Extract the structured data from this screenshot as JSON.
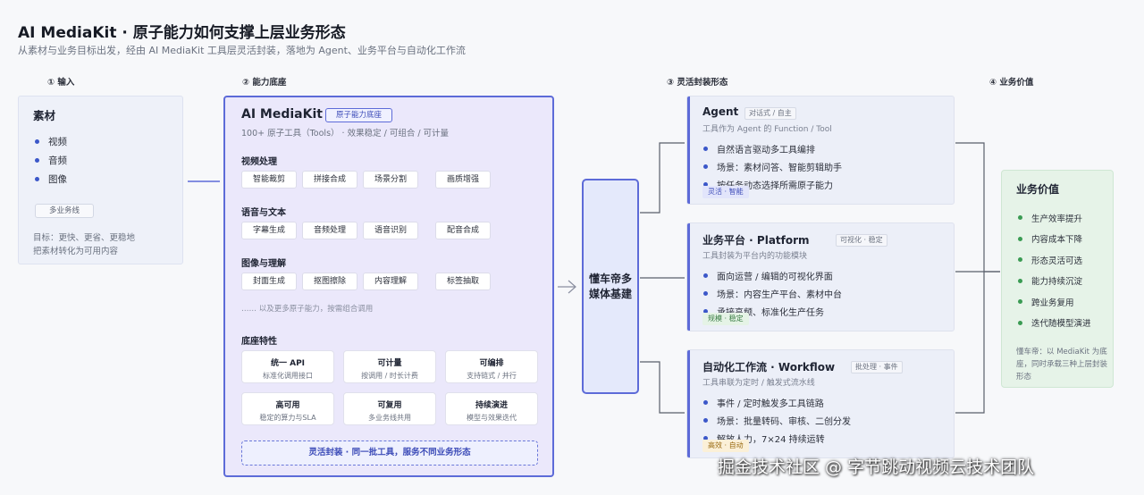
{
  "header": {
    "title": "AI MediaKit · 原子能力如何支撑上层业务形态",
    "subtitle": "从素材与业务目标出发，经由 AI MediaKit 工具层灵活封装，落地为 Agent、业务平台与自动化工作流"
  },
  "steps": {
    "s1": "① 输入",
    "s2": "② 能力底座",
    "s3": "③ 灵活封装形态",
    "s4": "④ 业务价值"
  },
  "input": {
    "heading": "素材",
    "items": [
      "视频",
      "音频",
      "图像"
    ],
    "pill": "多业务线",
    "desc1": "目标：更快、更省、更稳地",
    "desc2": "把素材转化为可用内容"
  },
  "core": {
    "title": "AI MediaKit",
    "tag": "原子能力底座",
    "sub": "100+ 原子工具（Tools） · 效果稳定 / 可组合 / 可计量",
    "groups": [
      {
        "label": "视频处理",
        "chips": [
          "智能裁剪",
          "拼接合成",
          "场景分割",
          "画质增强"
        ]
      },
      {
        "label": "语音与文本",
        "chips": [
          "字幕生成",
          "音频处理",
          "语音识别",
          "配音合成"
        ]
      },
      {
        "label": "图像与理解",
        "chips": [
          "封面生成",
          "抠图擦除",
          "内容理解",
          "标签抽取"
        ]
      }
    ],
    "more": "…… 以及更多原子能力，按需组合调用",
    "features_label": "底座特性",
    "features": [
      {
        "title": "统一 API",
        "desc": "标准化调用接口"
      },
      {
        "title": "可计量",
        "desc": "按调用 / 时长计费"
      },
      {
        "title": "可编排",
        "desc": "支持链式 / 并行"
      },
      {
        "title": "高可用",
        "desc": "稳定的算力与SLA"
      },
      {
        "title": "可复用",
        "desc": "多业务线共用"
      },
      {
        "title": "持续演进",
        "desc": "模型与效果迭代"
      }
    ],
    "banner": "灵活封装 · 同一批工具，服务不同业务形态"
  },
  "hub": {
    "label": "懂车帝多媒体基建"
  },
  "forms": [
    {
      "title": "Agent",
      "tag": "对话式 / 自主",
      "desc": "工具作为 Agent 的 Function / Tool",
      "bullets": [
        "自然语言驱动多工具编排",
        "场景：素材问答、智能剪辑助手",
        "按任务动态选择所需原子能力"
      ],
      "badge": "灵活 · 智能"
    },
    {
      "title": "业务平台 · Platform",
      "tag": "可视化 · 稳定",
      "desc": "工具封装为平台内的功能模块",
      "bullets": [
        "面向运营 / 编辑的可视化界面",
        "场景：内容生产平台、素材中台",
        "承接高频、标准化生产任务"
      ],
      "badge": "规模 · 稳定"
    },
    {
      "title": "自动化工作流 · Workflow",
      "tag": "批处理 · 事件",
      "desc": "工具串联为定时 / 触发式流水线",
      "bullets": [
        "事件 / 定时触发多工具链路",
        "场景：批量转码、审核、二创分发",
        "解放人力，7×24 持续运转"
      ],
      "badge": "高效 · 自动"
    }
  ],
  "value": {
    "title": "业务价值",
    "items": [
      "生产效率提升",
      "内容成本下降",
      "形态灵活可选",
      "能力持续沉淀",
      "跨业务复用",
      "迭代随模型演进"
    ],
    "desc": "懂车帝：以 MediaKit 为底座，同时承载三种上层封装形态"
  },
  "watermark": "掘金技术社区 @ 字节跳动视频云技术团队",
  "colors": {
    "accent": "#5d6bd8",
    "value_green": "#3a9b53",
    "badge_agent": "#e2e5fb",
    "badge_platform": "#e5f3e6",
    "badge_workflow": "#fbf0d8"
  }
}
